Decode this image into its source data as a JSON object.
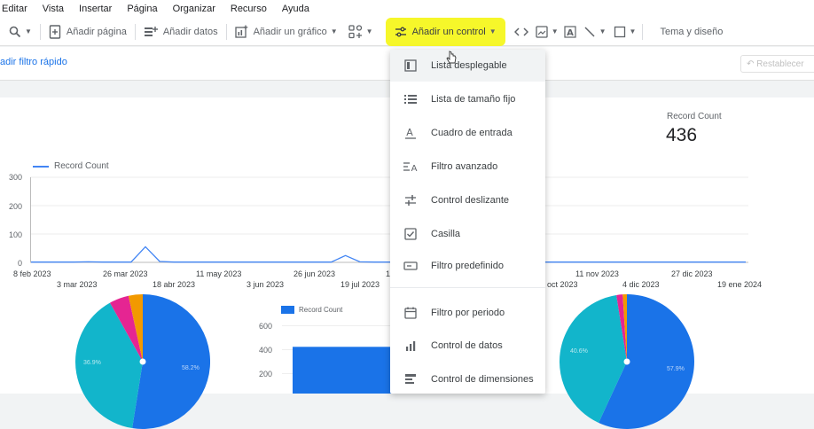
{
  "menubar": [
    "Editar",
    "Vista",
    "Insertar",
    "Página",
    "Organizar",
    "Recurso",
    "Ayuda"
  ],
  "toolbar": {
    "add_page": "Añadir página",
    "add_data": "Añadir datos",
    "add_chart": "Añadir un gráfico",
    "add_control": "Añadir un control",
    "theme": "Tema y diseño"
  },
  "filterbar": {
    "quick_filter": "adir filtro rápido",
    "reset": "Restablecer"
  },
  "time_chart": {
    "legend": "Record Count",
    "y_ticks": [
      "300",
      "200",
      "100",
      "0"
    ],
    "x_ticks_row1": [
      "8 feb 2023",
      "26 mar 2023",
      "11 may 2023",
      "26 jun 2023",
      "1",
      "11 nov 2023",
      "27 dic 2023"
    ],
    "x_ticks_row2": [
      "3 mar 2023",
      "18 abr 2023",
      "3 jun 2023",
      "19 jul 2023",
      "oct 2023",
      "4 dic 2023",
      "19 ene 2024"
    ]
  },
  "chart_data": {
    "type": "line",
    "title": "",
    "series": [
      {
        "name": "Record Count",
        "values": [
          1,
          1,
          1,
          1,
          2,
          1,
          1,
          1,
          55,
          3,
          1,
          1,
          1,
          1,
          1,
          1,
          1,
          1,
          1,
          1,
          1,
          1,
          24,
          2,
          1,
          1,
          1,
          1,
          1,
          1,
          1,
          1,
          12,
          1,
          1,
          1,
          1,
          1,
          1,
          1,
          1,
          1,
          1,
          1,
          1,
          1,
          1,
          1,
          1,
          1,
          1
        ]
      }
    ],
    "ylim": [
      0,
      300
    ],
    "xlabel": "",
    "ylabel": ""
  },
  "scorecard": {
    "label": "Record Count",
    "value": "436"
  },
  "bar_chart": {
    "legend": "Record Count",
    "y_ticks": [
      "600",
      "400",
      "200"
    ],
    "value": 420,
    "ylim": [
      0,
      600
    ]
  },
  "pie_left": {
    "label1": "58.2%",
    "label2": "36.9%",
    "slices": [
      {
        "value": 52.5,
        "color": "#1a73e8"
      },
      {
        "value": 39.4,
        "color": "#12b5cb"
      },
      {
        "value": 4.7,
        "color": "#e52592"
      },
      {
        "value": 3.4,
        "color": "#f29900"
      }
    ]
  },
  "pie_right": {
    "label1": "40.6%",
    "label2": "57.9%",
    "slices": [
      {
        "value": 56.9,
        "color": "#1a73e8"
      },
      {
        "value": 40.6,
        "color": "#12b5cb"
      },
      {
        "value": 1.5,
        "color": "#e52592"
      },
      {
        "value": 1.0,
        "color": "#f29900"
      }
    ]
  },
  "dropdown": {
    "items": [
      {
        "label": "Lista desplegable",
        "icon": "dropdown-list-icon"
      },
      {
        "label": "Lista de tamaño fijo",
        "icon": "fixed-list-icon"
      },
      {
        "label": "Cuadro de entrada",
        "icon": "input-box-icon"
      },
      {
        "label": "Filtro avanzado",
        "icon": "advanced-filter-icon"
      },
      {
        "label": "Control deslizante",
        "icon": "slider-icon"
      },
      {
        "label": "Casilla",
        "icon": "checkbox-icon"
      },
      {
        "label": "Filtro predefinido",
        "icon": "preset-filter-icon"
      },
      {
        "label": "Filtro por periodo",
        "icon": "calendar-icon"
      },
      {
        "label": "Control de datos",
        "icon": "data-control-icon"
      },
      {
        "label": "Control de dimensiones",
        "icon": "dimension-control-icon"
      }
    ]
  },
  "colors": {
    "accent": "#1a73e8",
    "highlight": "#f6f72a"
  }
}
